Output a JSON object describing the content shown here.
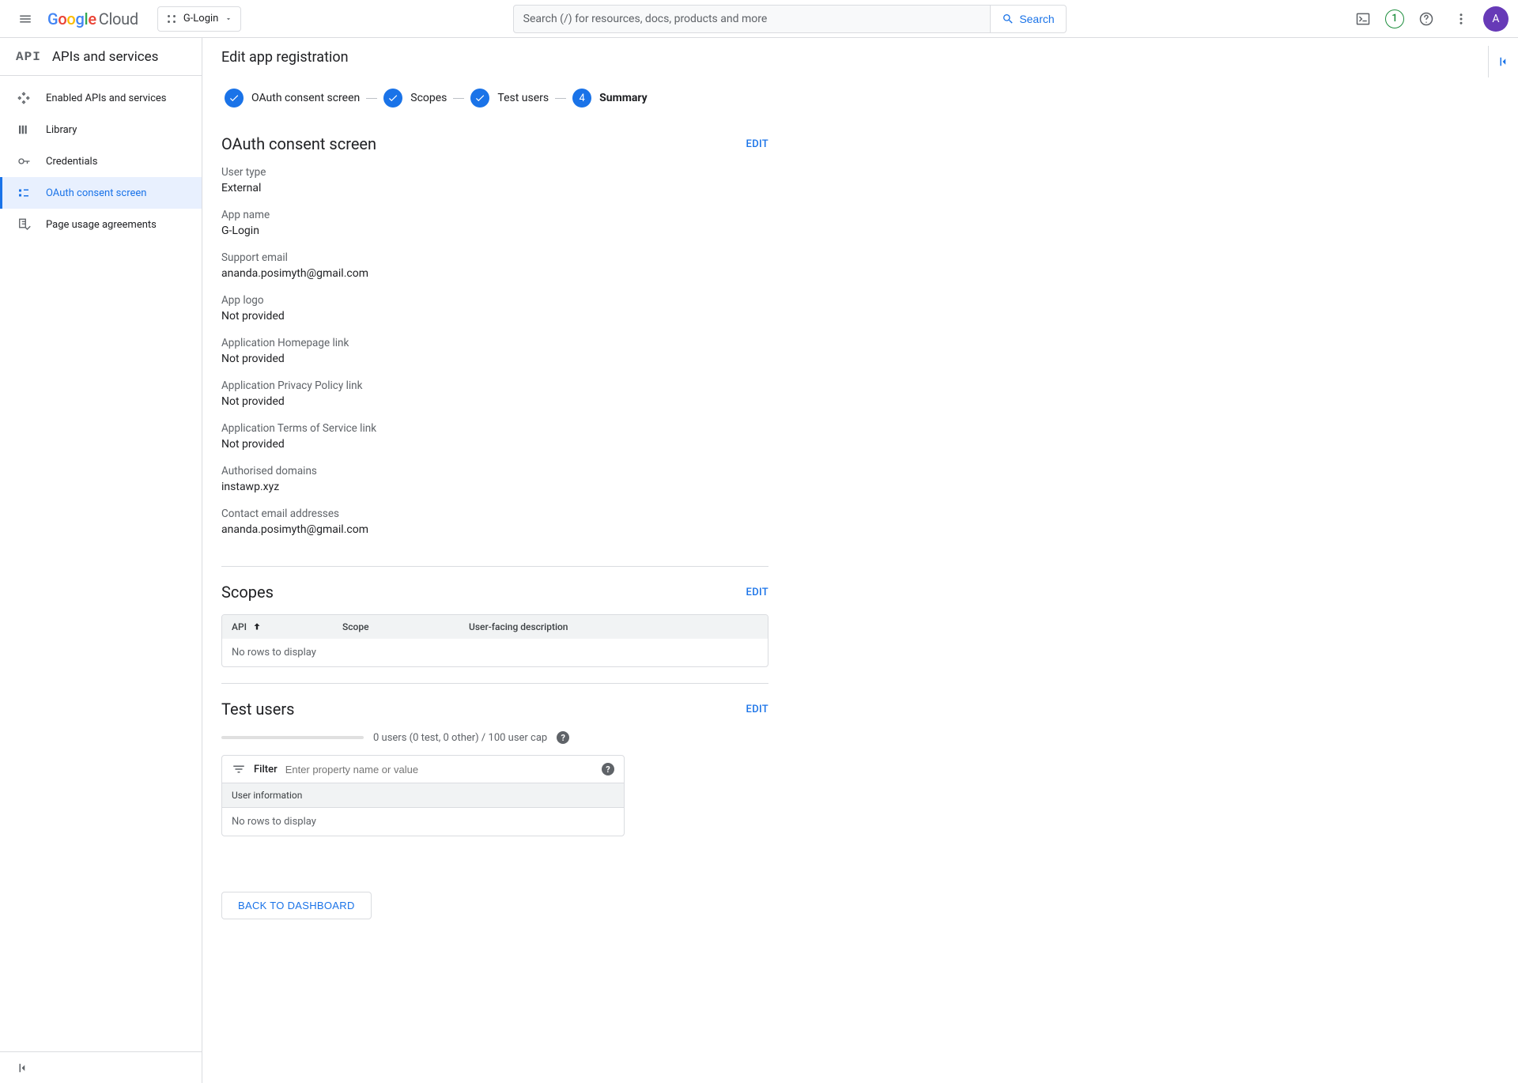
{
  "header": {
    "project_name": "G-Login",
    "search_placeholder": "Search (/) for resources, docs, products and more",
    "search_btn": "Search",
    "trial_badge": "1",
    "avatar_letter": "A"
  },
  "sidebar": {
    "title": "APIs and services",
    "items": [
      {
        "label": "Enabled APIs and services"
      },
      {
        "label": "Library"
      },
      {
        "label": "Credentials"
      },
      {
        "label": "OAuth consent screen"
      },
      {
        "label": "Page usage agreements"
      }
    ]
  },
  "page": {
    "title": "Edit app registration",
    "steps": [
      {
        "label": "OAuth consent screen"
      },
      {
        "label": "Scopes"
      },
      {
        "label": "Test users"
      },
      {
        "label": "Summary",
        "num": "4"
      }
    ]
  },
  "oauth": {
    "title": "OAuth consent screen",
    "edit": "EDIT",
    "fields": [
      {
        "label": "User type",
        "value": "External"
      },
      {
        "label": "App name",
        "value": "G-Login"
      },
      {
        "label": "Support email",
        "value": "ananda.posimyth@gmail.com"
      },
      {
        "label": "App logo",
        "value": "Not provided"
      },
      {
        "label": "Application Homepage link",
        "value": "Not provided"
      },
      {
        "label": "Application Privacy Policy link",
        "value": "Not provided"
      },
      {
        "label": "Application Terms of Service link",
        "value": "Not provided"
      },
      {
        "label": "Authorised domains",
        "value": "instawp.xyz"
      },
      {
        "label": "Contact email addresses",
        "value": "ananda.posimyth@gmail.com"
      }
    ]
  },
  "scopes": {
    "title": "Scopes",
    "edit": "EDIT",
    "columns": {
      "api": "API",
      "scope": "Scope",
      "desc": "User-facing description"
    },
    "empty": "No rows to display"
  },
  "test_users": {
    "title": "Test users",
    "edit": "EDIT",
    "progress_text": "0 users (0 test, 0 other) / 100 user cap",
    "filter_label": "Filter",
    "filter_placeholder": "Enter property name or value",
    "table_header": "User information",
    "empty": "No rows to display"
  },
  "back_btn": "BACK TO DASHBOARD"
}
